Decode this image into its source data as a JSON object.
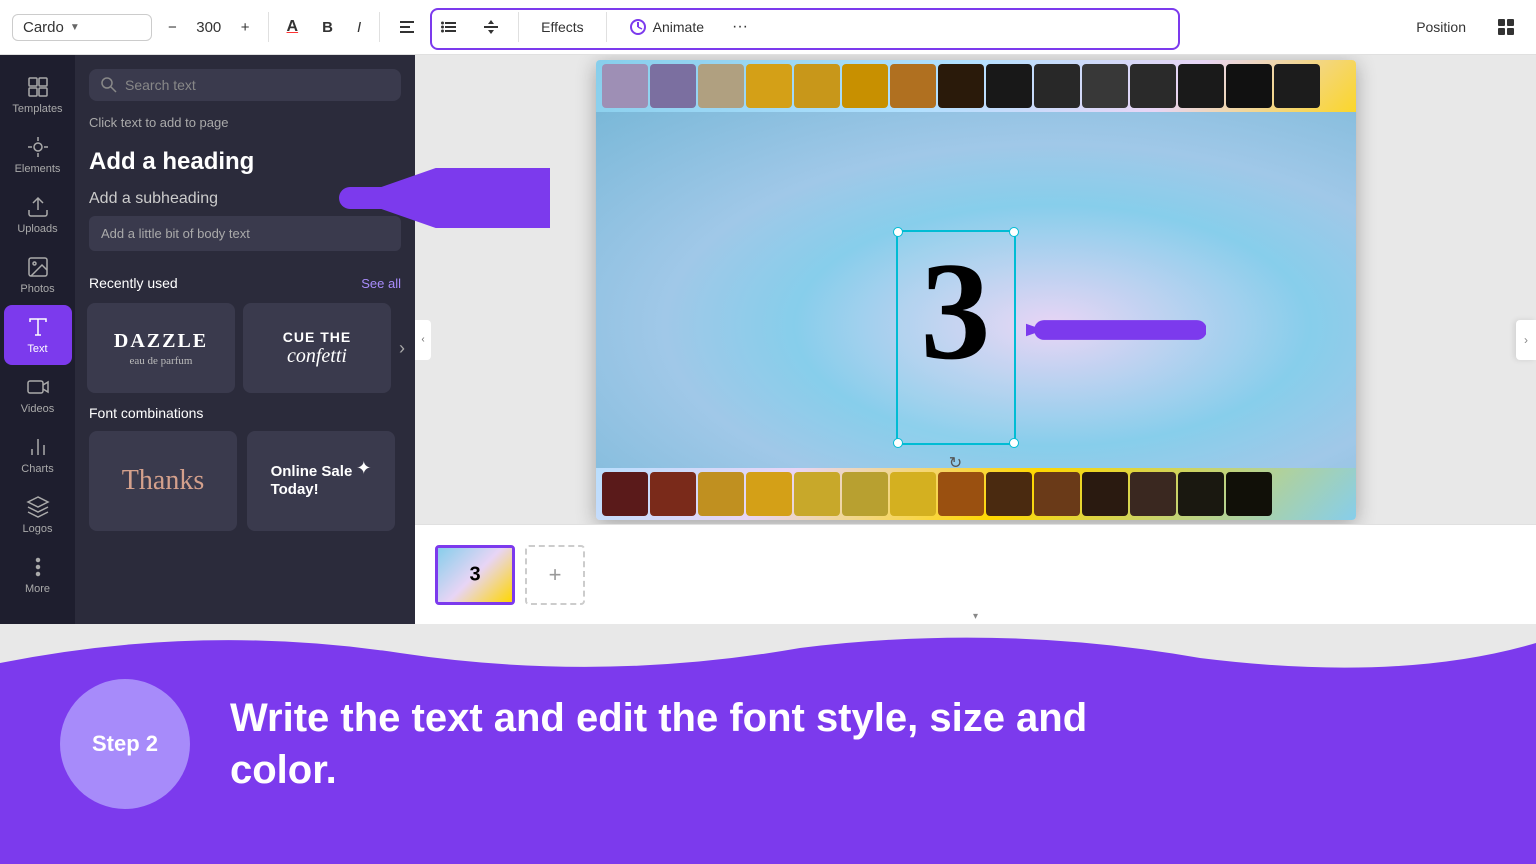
{
  "toolbar": {
    "font_name": "Cardo",
    "font_size": "300",
    "minus_label": "−",
    "plus_label": "+",
    "bold_label": "B",
    "italic_label": "I",
    "effects_label": "Effects",
    "animate_label": "Animate",
    "more_label": "···",
    "position_label": "Position",
    "text_color_label": "A",
    "align_label": "≡",
    "list_label": "☰",
    "spacing_label": "↕"
  },
  "sidebar": {
    "items": [
      {
        "id": "templates",
        "label": "Templates",
        "icon": "grid"
      },
      {
        "id": "elements",
        "label": "Elements",
        "icon": "elements"
      },
      {
        "id": "uploads",
        "label": "Uploads",
        "icon": "upload"
      },
      {
        "id": "photos",
        "label": "Photos",
        "icon": "photos"
      },
      {
        "id": "text",
        "label": "Text",
        "icon": "text",
        "active": true
      },
      {
        "id": "videos",
        "label": "Videos",
        "icon": "video"
      },
      {
        "id": "charts",
        "label": "Charts",
        "icon": "chart"
      },
      {
        "id": "logos",
        "label": "Logos",
        "icon": "logo"
      },
      {
        "id": "more",
        "label": "More",
        "icon": "more"
      }
    ]
  },
  "panel": {
    "search_placeholder": "Search text",
    "click_hint": "Click text to add to page",
    "add_heading": "Add a heading",
    "add_subheading": "Add a subheading",
    "add_body": "Add a little bit of body text",
    "recently_used_title": "Recently used",
    "see_all": "See all",
    "font_card_1_line1": "DAZZLE",
    "font_card_1_line2": "eau de parfum",
    "font_card_2_text": "CUE THE\nconfetti",
    "font_combos_title": "Font combinations",
    "combo_card_1_text": "Thanks",
    "combo_card_2_line1": "Online Sale",
    "combo_card_2_line2": "Today!"
  },
  "canvas": {
    "number_text": "3",
    "film_swatches_top": [
      "#9e8fb5",
      "#7b6fa0",
      "#b0a080",
      "#d4a017",
      "#c8971a",
      "#c89000",
      "#b07020",
      "#2a1a0a",
      "#181818",
      "#282828",
      "#383838",
      "#2a2a2a",
      "#1a1a1a"
    ],
    "film_swatches_bottom": [
      "#5a1a1a",
      "#7a2a1a",
      "#c09020",
      "#d4a017",
      "#c8a82a",
      "#b8a030",
      "#d4b020",
      "#9a5010",
      "#4a2a10",
      "#6a3a18",
      "#2a1a10",
      "#3a2820",
      "#1a1810"
    ]
  },
  "slides": {
    "add_label": "+"
  },
  "bottom_section": {
    "step_label": "Step 2",
    "description": "Write the text and edit the font style, size and color."
  }
}
